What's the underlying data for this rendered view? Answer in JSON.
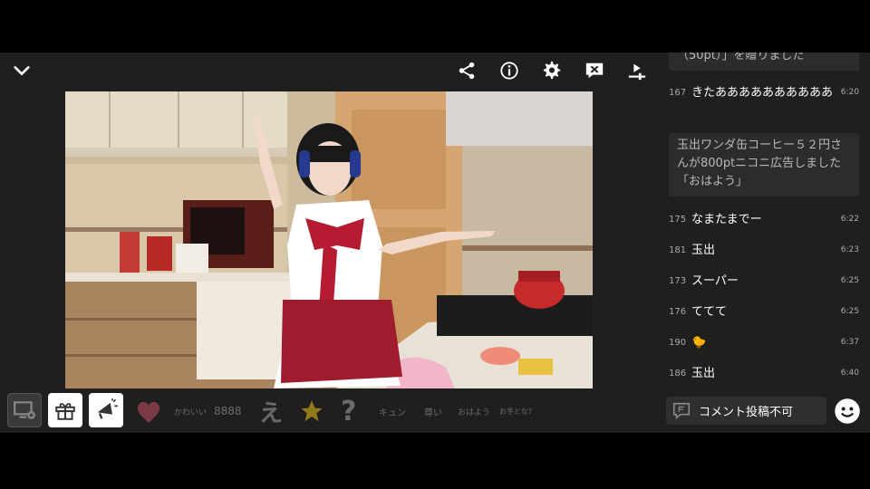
{
  "topbar": {
    "icons": [
      "chevron-down-icon",
      "share-icon",
      "info-icon",
      "gear-icon",
      "comment-hide-icon",
      "quality-icon"
    ]
  },
  "reactions": {
    "buttons": [
      "screen-add-icon",
      "gift-icon",
      "megaphone-icon"
    ],
    "stamps": [
      {
        "name": "heart-stamp",
        "label": ""
      },
      {
        "name": "kawaii-stamp",
        "label": "かわいい"
      },
      {
        "name": "8888-stamp",
        "label": "8888"
      },
      {
        "name": "e-stamp",
        "label": "え"
      },
      {
        "name": "star-stamp",
        "label": ""
      },
      {
        "name": "question-stamp",
        "label": "?"
      },
      {
        "name": "kyun-stamp",
        "label": "キュン"
      },
      {
        "name": "sonkii-stamp",
        "label": "尊い"
      },
      {
        "name": "ohayou-stamp",
        "label": "おはよう"
      },
      {
        "name": "oshite-stamp",
        "label": "お手とな?"
      }
    ],
    "colors": {
      "heart": "#7a3a48",
      "star": "#8f7a1e"
    }
  },
  "comments": {
    "top_notice": "（50pt）」を贈りました",
    "rows_before": [
      {
        "number": "167",
        "text": "きたああああああああああ",
        "time": "6:20"
      }
    ],
    "ad_notice": "玉出ワンダ缶コーヒー５２円さんが800ptニコニ広告しました「おはよう」",
    "rows_after": [
      {
        "number": "175",
        "text": "なまたまでー",
        "time": "6:22"
      },
      {
        "number": "181",
        "text": "玉出",
        "time": "6:23"
      },
      {
        "number": "173",
        "text": "スーパー",
        "time": "6:25"
      },
      {
        "number": "176",
        "text": "ててて",
        "time": "6:25"
      },
      {
        "number": "190",
        "text": "🐤",
        "time": "6:37"
      },
      {
        "number": "186",
        "text": "玉出",
        "time": "6:40"
      }
    ]
  },
  "comment_input": {
    "placeholder": "コメント投稿不可",
    "emoji_icon": "smiley-icon"
  }
}
